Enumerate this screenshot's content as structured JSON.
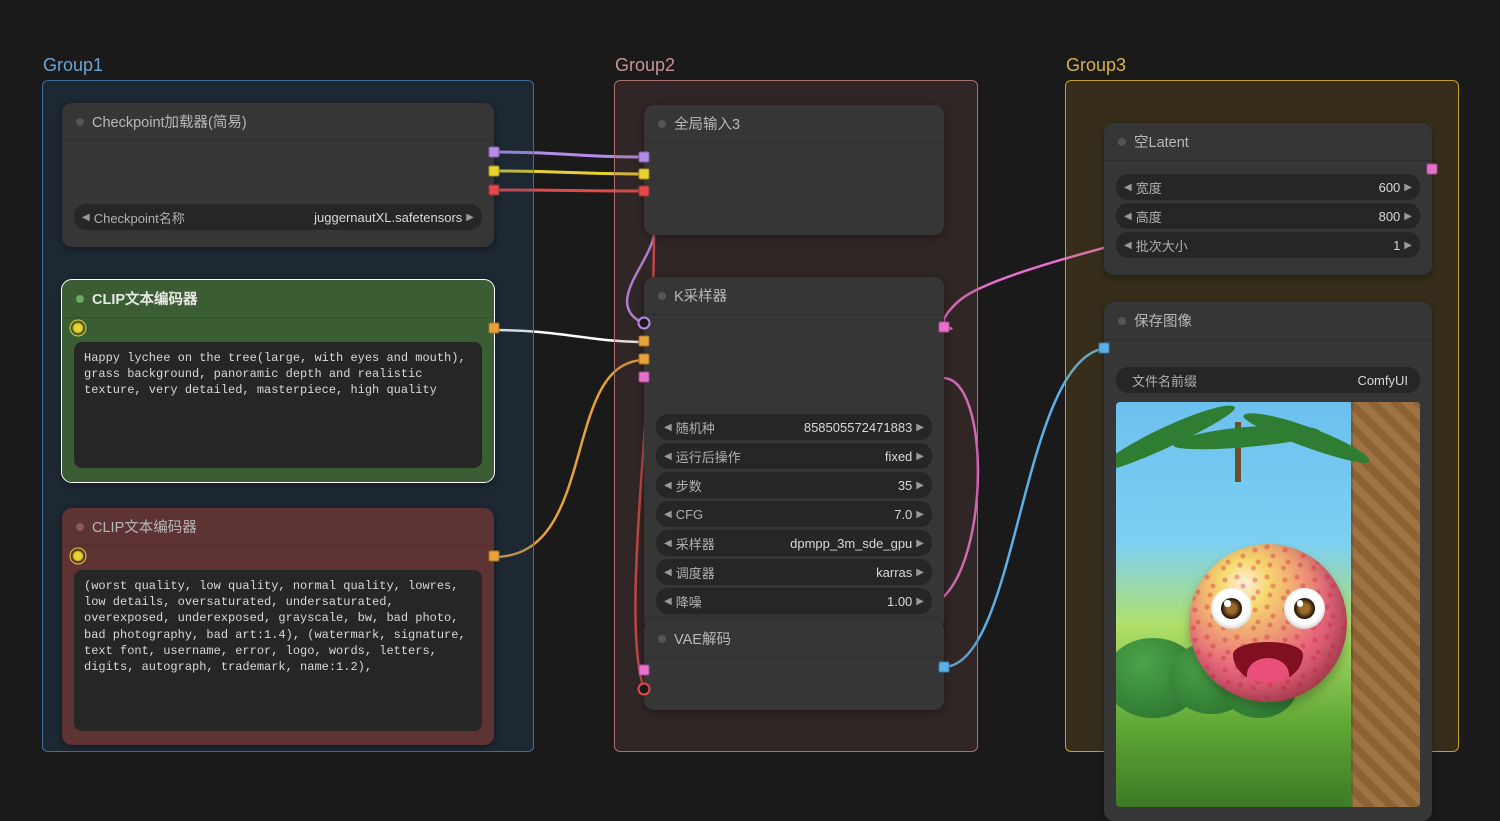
{
  "groups": {
    "g1": {
      "title": "Group1",
      "color": "#3d6e9e",
      "fill": "rgba(40, 90, 140, 0.22)"
    },
    "g2": {
      "title": "Group2",
      "color": "#a86e6e",
      "fill": "rgba(130, 80, 80, 0.22)"
    },
    "g3": {
      "title": "Group3",
      "color": "#c9a12a",
      "fill": "rgba(170, 130, 30, 0.20)"
    }
  },
  "nodes": {
    "checkpoint": {
      "title": "Checkpoint加载器(简易)",
      "widget": {
        "label": "Checkpoint名称",
        "value": "juggernautXL.safetensors"
      }
    },
    "clip_pos": {
      "title": "CLIP文本编码器",
      "fill": "#3a5d33",
      "text": "Happy lychee on the tree(large, with eyes and mouth), grass background, panoramic depth and realistic texture, very detailed, masterpiece, high quality"
    },
    "clip_neg": {
      "title": "CLIP文本编码器",
      "fill": "#5d3333",
      "text": "(worst quality, low quality, normal quality, lowres, low details, oversaturated, undersaturated, overexposed, underexposed, grayscale, bw, bad photo, bad photography, bad art:1.4), (watermark, signature, text font, username, error, logo, words, letters, digits, autograph, trademark, name:1.2),"
    },
    "reroute": {
      "title": "全局输入3"
    },
    "ksampler": {
      "title": "K采样器",
      "widgets": [
        {
          "label": "随机种",
          "value": "858505572471883"
        },
        {
          "label": "运行后操作",
          "value": "fixed"
        },
        {
          "label": "步数",
          "value": "35"
        },
        {
          "label": "CFG",
          "value": "7.0"
        },
        {
          "label": "采样器",
          "value": "dpmpp_3m_sde_gpu"
        },
        {
          "label": "调度器",
          "value": "karras"
        },
        {
          "label": "降噪",
          "value": "1.00"
        }
      ]
    },
    "vae_decode": {
      "title": "VAE解码"
    },
    "empty_latent": {
      "title": "空Latent",
      "widgets": [
        {
          "label": "宽度",
          "value": "600"
        },
        {
          "label": "高度",
          "value": "800"
        },
        {
          "label": "批次大小",
          "value": "1"
        }
      ]
    },
    "save_image": {
      "title": "保存图像",
      "widget": {
        "label": "文件名前缀",
        "value": "ComfyUI"
      }
    }
  }
}
